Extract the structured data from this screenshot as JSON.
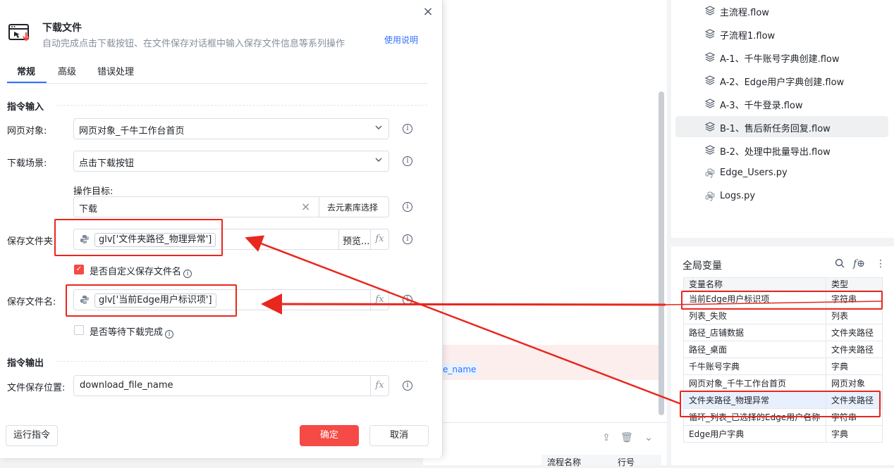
{
  "modal": {
    "title": "下载文件",
    "subtitle": "自动完成点击下载按钮、在文件保存对话框中输入保存文件信息等系列操作",
    "help_link": "使用说明",
    "tabs": [
      "常规",
      "高级",
      "错误处理"
    ],
    "section_input": "指令输入",
    "section_output": "指令输出",
    "fields": {
      "web_object_label": "网页对象:",
      "web_object_value": "网页对象_千牛工作台首页",
      "scene_label": "下载场景:",
      "scene_value": "点击下载按钮",
      "target_label": "操作目标:",
      "target_value": "下载",
      "target_pick_label": "去元素库选择",
      "save_folder_label": "保存文件夹",
      "save_folder_value": "glv['文件夹路径_物理异常']",
      "preview_label": "预览...",
      "custom_name_label": "是否自定义保存文件名",
      "save_name_label": "保存文件名:",
      "save_name_value": "glv['当前Edge用户标识项']",
      "wait_label": "是否等待下载完成",
      "output_label": "文件保存位置:",
      "output_value": "download_file_name",
      "fx": "fx"
    },
    "buttons": {
      "run": "运行指令",
      "ok": "确定",
      "cancel": "取消"
    }
  },
  "background": {
    "tag_text": "e_name",
    "table_headers": [
      "流程名称",
      "行号"
    ]
  },
  "files": {
    "items": [
      {
        "name": "主流程.flow",
        "type": "flow"
      },
      {
        "name": "子流程1.flow",
        "type": "flow"
      },
      {
        "name": "A-1、千牛账号字典创建.flow",
        "type": "flow"
      },
      {
        "name": "A-2、Edge用户字典创建.flow",
        "type": "flow"
      },
      {
        "name": "A-3、千牛登录.flow",
        "type": "flow"
      },
      {
        "name": "B-1、售后新任务回复.flow",
        "type": "flow"
      },
      {
        "name": "B-2、处理中批量导出.flow",
        "type": "flow"
      },
      {
        "name": "Edge_Users.py",
        "type": "py"
      },
      {
        "name": "Logs.py",
        "type": "py"
      }
    ],
    "active_index": 5
  },
  "variables": {
    "title": "全局变量",
    "headers": [
      "变量名称",
      "类型"
    ],
    "rows": [
      [
        "当前Edge用户标识项",
        "字符串"
      ],
      [
        "列表_失败",
        "列表"
      ],
      [
        "路径_店铺数据",
        "文件夹路径"
      ],
      [
        "路径_桌面",
        "文件夹路径"
      ],
      [
        "千牛账号字典",
        "字典"
      ],
      [
        "网页对象_千牛工作台首页",
        "网页对象"
      ],
      [
        "文件夹路径_物理异常",
        "文件夹路径"
      ],
      [
        "循环_列表_已选择的Edge用户名称",
        "字符串"
      ],
      [
        "Edge用户字典",
        "字典"
      ]
    ]
  },
  "colors": {
    "accent": "#3370ff",
    "primary_button": "#f54a45",
    "annotation_red": "#e8271e"
  }
}
